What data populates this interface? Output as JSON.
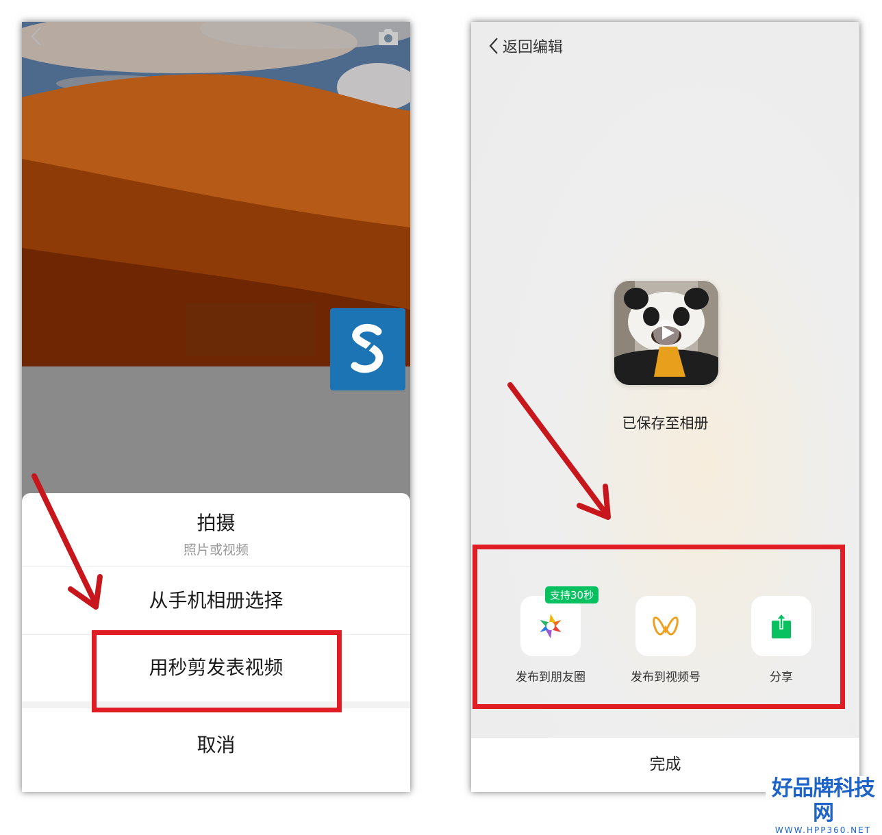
{
  "left_phone": {
    "sheet": {
      "shoot_label": "拍摄",
      "shoot_sublabel": "照片或视频",
      "album_label": "从手机相册选择",
      "miaojian_label": "用秒剪发表视频",
      "cancel_label": "取消"
    },
    "icons": {
      "back": "chevron-left-icon",
      "camera": "camera-icon",
      "app_logo": "miaojian-s-logo"
    }
  },
  "right_phone": {
    "return_label": "返回编辑",
    "saved_label": "已保存至相册",
    "share_options": [
      {
        "label": "发布到朋友圈",
        "badge": "支持30秒",
        "icon": "moments-aperture-icon"
      },
      {
        "label": "发布到视频号",
        "icon": "channels-butterfly-icon"
      },
      {
        "label": "分享",
        "icon": "share-upload-icon"
      }
    ],
    "done_label": "完成"
  },
  "watermark": {
    "main": "好品牌科技网",
    "sub": "WWW.HPP360.NET"
  },
  "colors": {
    "highlight": "#e01d24",
    "wechat_green": "#07c160",
    "s_logo_blue": "#1d74b4",
    "watermark_blue": "#1d63c8"
  }
}
